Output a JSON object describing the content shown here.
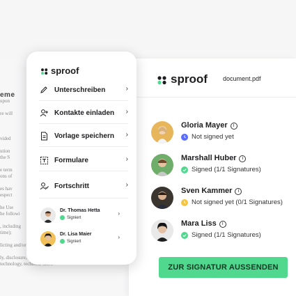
{
  "brand": {
    "name": "sproof",
    "dot_colors": [
      "#1d1d20",
      "#4fd88e"
    ]
  },
  "document_name": "document.pdf",
  "doc_background": {
    "heading_fragment": "eme",
    "lines": [
      "upon",
      "",
      "re will",
      "",
      "",
      "",
      "vided",
      "",
      "ution",
      "the S",
      "",
      "e term",
      "ons of",
      "",
      "es hav",
      "espect",
      "",
      "he Use",
      "he followi",
      "",
      ", including",
      "time);",
      "",
      "licting and/or regulating:",
      "",
      "ly, disclosure, transfer or",
      "technology, technical know-"
    ]
  },
  "menu": {
    "items": [
      {
        "label": "Unterschreiben",
        "icon": "pen-icon"
      },
      {
        "label": "Kontakte einladen",
        "icon": "add-user-icon"
      },
      {
        "label": "Vorlage speichern",
        "icon": "document-icon"
      },
      {
        "label": "Formulare",
        "icon": "form-icon"
      },
      {
        "label": "Fortschritt",
        "icon": "progress-user-icon"
      }
    ],
    "chevron": "›",
    "signers": [
      {
        "name": "Dr. Thomas Hetta",
        "status": "Signiert",
        "status_color": "#4fd88e"
      },
      {
        "name": "Dr. Lisa Maier",
        "status": "Signiert",
        "status_color": "#4fd88e"
      }
    ]
  },
  "signers": [
    {
      "name": "Gloria Mayer",
      "status": "Not signed yet",
      "status_color": "#5b6cff",
      "status_icon": "clock-icon"
    },
    {
      "name": "Marshall Huber",
      "status": "Signed (1/1 Signatures)",
      "status_color": "#4fd88e",
      "status_icon": "check-icon"
    },
    {
      "name": "Sven Kammer",
      "status": "Not signed yet (0/1 Signatures)",
      "status_color": "#f5c542",
      "status_icon": "clock-icon"
    },
    {
      "name": "Mara Liss",
      "status": "Signed (1/1 Signatures)",
      "status_color": "#4fd88e",
      "status_icon": "check-icon"
    }
  ],
  "info_glyph": "i",
  "send_button": {
    "label": "ZUR SIGNATUR AUSSENDEN",
    "color": "#4fd88e"
  }
}
